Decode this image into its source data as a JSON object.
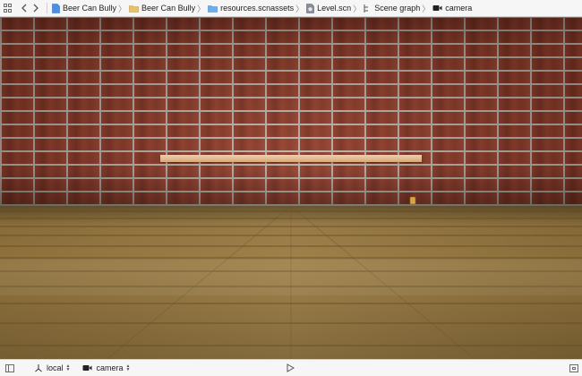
{
  "breadcrumb": {
    "items": [
      {
        "label": "Beer Can Bully",
        "icon": "swift-file-icon"
      },
      {
        "label": "Beer Can Bully",
        "icon": "folder-icon"
      },
      {
        "label": "resources.scnassets",
        "icon": "folder-icon"
      },
      {
        "label": "Level.scn",
        "icon": "scene-file-icon"
      },
      {
        "label": "Scene graph",
        "icon": "scene-graph-icon"
      },
      {
        "label": "camera",
        "icon": "camera-icon"
      }
    ]
  },
  "scene": {
    "wall_color": "#8e3b29",
    "mortar_color": "#bdb4aa",
    "shelf_color": "#e8c19a",
    "floor_color": "#9b7b41"
  },
  "bottombar": {
    "coordinate_space": "local",
    "point_of_view": "camera"
  },
  "colors": {
    "bar_bg": "#f6f6f6",
    "accent_folder": "#6aaef0"
  }
}
